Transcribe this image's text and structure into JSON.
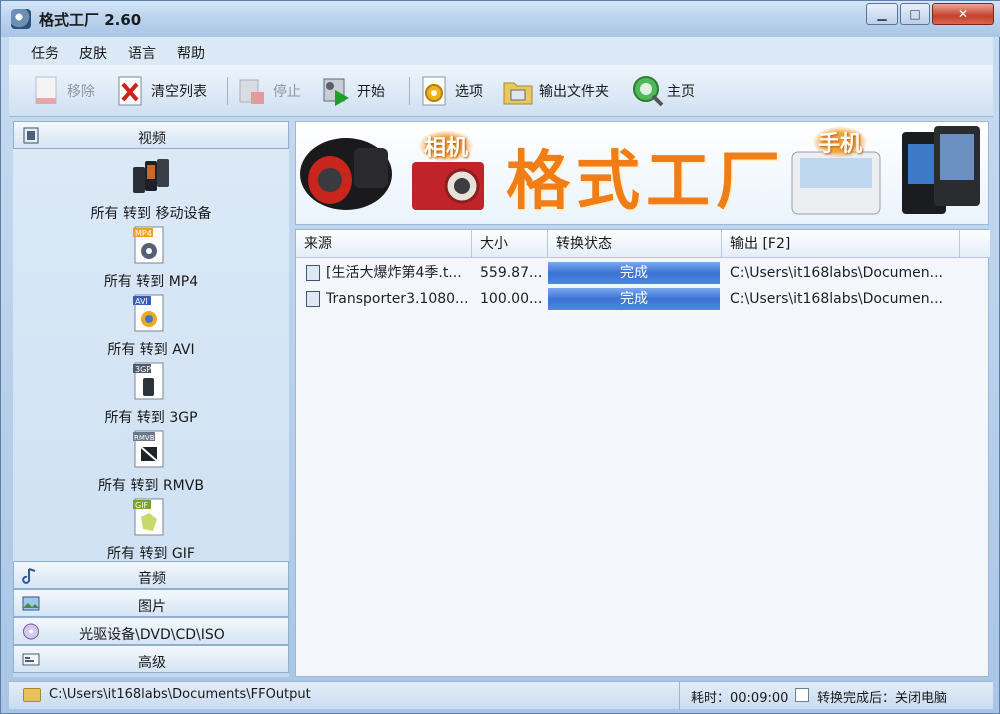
{
  "window": {
    "title": "格式工厂 2.60"
  },
  "menu": [
    "任务",
    "皮肤",
    "语言",
    "帮助"
  ],
  "toolbar": {
    "remove": "移除",
    "clear_list": "清空列表",
    "stop": "停止",
    "start": "开始",
    "options": "选项",
    "output_folder": "输出文件夹",
    "home": "主页"
  },
  "sidebar": {
    "video_header": "视频",
    "formats": [
      "所有 转到 移动设备",
      "所有 转到 MP4",
      "所有 转到 AVI",
      "所有 转到 3GP",
      "所有 转到 RMVB",
      "所有 转到 GIF"
    ],
    "format_badges": [
      "",
      "MP4",
      "AVI",
      "3GP",
      "RMVB",
      "GIF"
    ],
    "audio_header": "音频",
    "picture_header": "图片",
    "optical_header": "光驱设备\\DVD\\CD\\ISO",
    "advanced_header": "高级"
  },
  "banner": {
    "title": "格式工厂",
    "camera_tag": "相机",
    "phone_tag": "手机"
  },
  "table": {
    "headers": [
      "来源",
      "大小",
      "转换状态",
      "输出 [F2]"
    ],
    "rows": [
      {
        "source": "[生活大爆炸第4季.t...",
        "size": "559.87...",
        "status": "完成",
        "output": "C:\\Users\\it168labs\\Documen..."
      },
      {
        "source": "Transporter3.1080...",
        "size": "100.00...",
        "status": "完成",
        "output": "C:\\Users\\it168labs\\Documen..."
      }
    ]
  },
  "statusbar": {
    "path": "C:\\Users\\it168labs\\Documents\\FFOutput",
    "elapsed": "耗时：00:09:00",
    "after_done": "转换完成后：关闭电脑"
  },
  "colors": {
    "accent_orange": "#f07d16",
    "progress_blue": "#3c73d4",
    "close_red": "#c4412c"
  }
}
